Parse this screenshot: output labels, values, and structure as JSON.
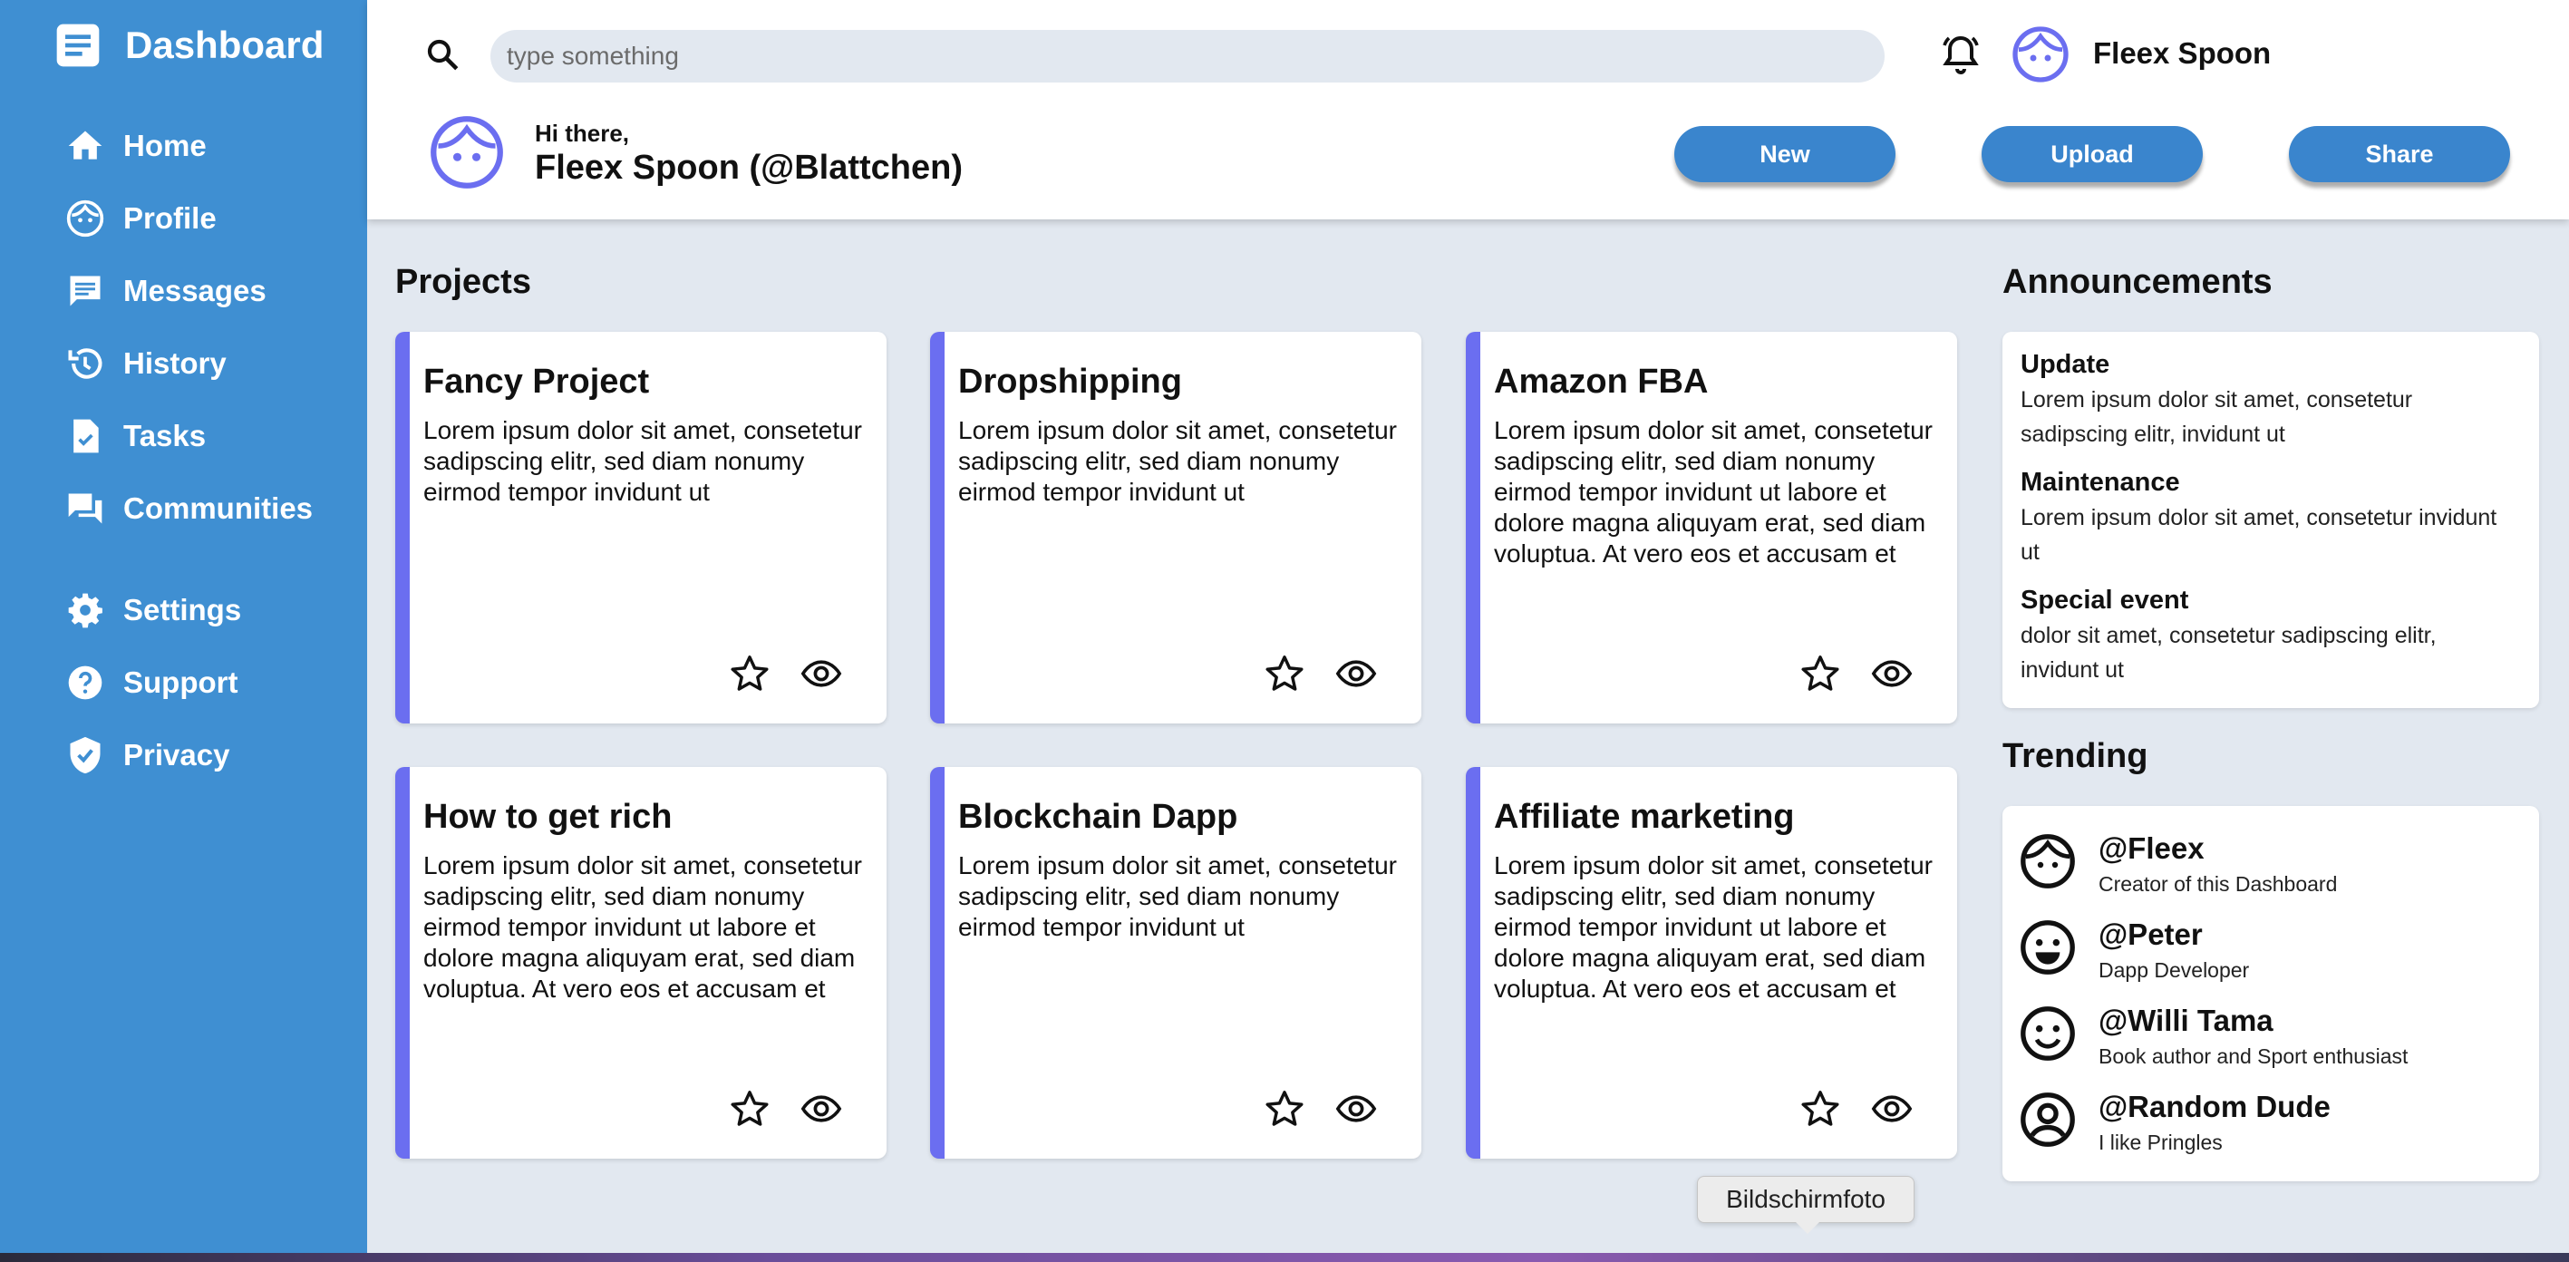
{
  "sidebar": {
    "brand": "Dashboard",
    "items": [
      {
        "label": "Home",
        "icon": "home-icon"
      },
      {
        "label": "Profile",
        "icon": "face-icon"
      },
      {
        "label": "Messages",
        "icon": "message-icon"
      },
      {
        "label": "History",
        "icon": "history-icon"
      },
      {
        "label": "Tasks",
        "icon": "task-icon"
      },
      {
        "label": "Communities",
        "icon": "forum-icon"
      },
      {
        "label": "Settings",
        "icon": "gear-icon"
      },
      {
        "label": "Support",
        "icon": "help-icon"
      },
      {
        "label": "Privacy",
        "icon": "shield-icon"
      }
    ],
    "color": "#3f8fd2"
  },
  "header": {
    "search_placeholder": "type something",
    "username": "Fleex Spoon",
    "greeting": "Hi there,",
    "greeting_name": "Fleex Spoon (@Blattchen)",
    "buttons": {
      "new": "New",
      "upload": "Upload",
      "share": "Share"
    },
    "button_color": "#3a85cd"
  },
  "projects": {
    "title": "Projects",
    "accent": "#6b6ef0",
    "cards": [
      {
        "title": "Fancy Project",
        "text": "Lorem ipsum dolor sit amet, consetetur sadipscing elitr, sed diam nonumy eirmod tempor invidunt ut"
      },
      {
        "title": "Dropshipping",
        "text": "Lorem ipsum dolor sit amet, consetetur sadipscing elitr, sed diam nonumy eirmod tempor invidunt ut"
      },
      {
        "title": "Amazon FBA",
        "text": "Lorem ipsum dolor sit amet, consetetur sadipscing elitr, sed diam nonumy eirmod tempor invidunt ut labore et dolore magna aliquyam erat, sed diam voluptua. At vero eos et accusam et"
      },
      {
        "title": "How to get rich",
        "text": "Lorem ipsum dolor sit amet, consetetur sadipscing elitr, sed diam nonumy eirmod tempor invidunt ut labore et dolore magna aliquyam erat, sed diam voluptua. At vero eos et accusam et"
      },
      {
        "title": "Blockchain Dapp",
        "text": "Lorem ipsum dolor sit amet, consetetur sadipscing elitr, sed diam nonumy eirmod tempor invidunt ut"
      },
      {
        "title": "Affiliate marketing",
        "text": "Lorem ipsum dolor sit amet, consetetur sadipscing elitr, sed diam nonumy eirmod tempor invidunt ut labore et dolore magna aliquyam erat, sed diam voluptua. At vero eos et accusam et"
      }
    ]
  },
  "announcements": {
    "title": "Announcements",
    "items": [
      {
        "title": "Update",
        "text": "Lorem ipsum dolor sit amet, consetetur sadipscing elitr, invidunt ut"
      },
      {
        "title": "Maintenance",
        "text": "Lorem ipsum dolor sit amet, consetetur invidunt ut"
      },
      {
        "title": "Special event",
        "text": "dolor sit amet, consetetur sadipscing elitr, invidunt ut"
      }
    ]
  },
  "trending": {
    "title": "Trending",
    "items": [
      {
        "name": "@Fleex",
        "desc": "Creator of this Dashboard",
        "icon": "baby-face-icon"
      },
      {
        "name": "@Peter",
        "desc": "Dapp Developer",
        "icon": "smiley-icon"
      },
      {
        "name": "@Willi Tama",
        "desc": "Book author and Sport enthusiast",
        "icon": "smiley-outline-icon"
      },
      {
        "name": "@Random Dude",
        "desc": "I like Pringles",
        "icon": "account-circle-icon"
      }
    ]
  },
  "tooltip": "Bildschirmfoto"
}
